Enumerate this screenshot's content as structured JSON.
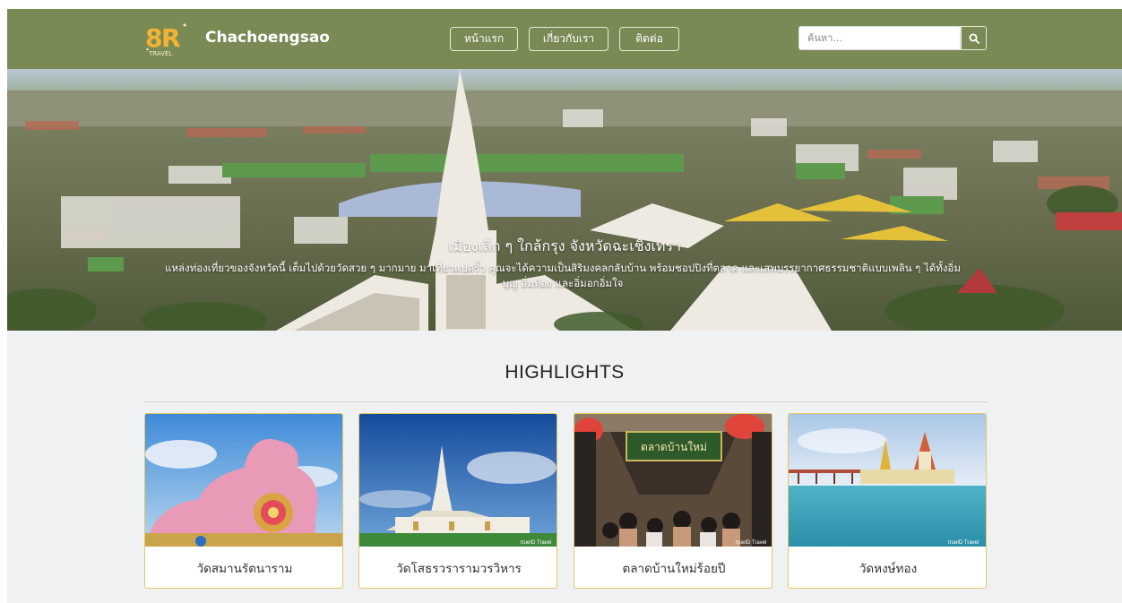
{
  "brand": {
    "logo_text": "8R",
    "logo_sub": "TRAVEL",
    "name": "Chachoengsao"
  },
  "nav": {
    "items": [
      {
        "label": "หน้าแรก"
      },
      {
        "label": "เกี่ยวกับเรา"
      },
      {
        "label": "ติดต่อ"
      }
    ]
  },
  "search": {
    "placeholder": "ค้นหา..."
  },
  "hero": {
    "title": "เมืองเล็ก ๆ ใกล้กรุง จังหวัดฉะเชิงเทรา",
    "subtitle": "แหล่งท่องเที่ยวของจังหวัดนี้ เต็มไปด้วยวัดสวย ๆ มากมาย มาเที่ยวแปดริ้ว คุณจะได้ความเป็นสิริมงคลกลับบ้าน พร้อมชอปปิงที่ตลาด และเสพบรรยากาศธรรมชาติแบบเพลิน ๆ ได้ทั้งอิ่มบุญ อิ่มท้อง และอิ่มอกอิ่มใจ"
  },
  "highlights": {
    "title": "HIGHLIGHTS",
    "cards": [
      {
        "caption": "วัดสมานรัตนาราม"
      },
      {
        "caption": "วัดโสธรวรารามวรวิหาร",
        "watermark": "trueID Travel"
      },
      {
        "caption": "ตลาดบ้านใหม่ร้อยปี",
        "sign": "ตลาดบ้านใหม่",
        "watermark": "trueID Travel"
      },
      {
        "caption": "วัดหงษ์ทอง",
        "watermark": "trueID Travel"
      }
    ]
  },
  "colors": {
    "navbar": "#7a8a55",
    "card_border": "#e3c766",
    "background": "#eff1f2"
  },
  "icons": {
    "search": "magnifier-icon"
  }
}
